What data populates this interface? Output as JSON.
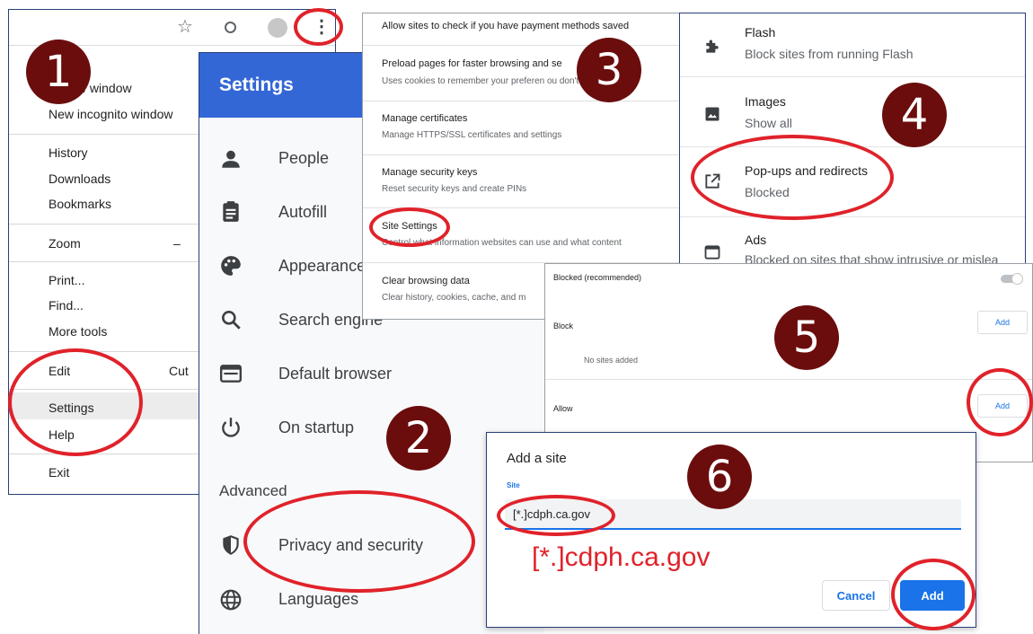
{
  "menu": {
    "item_1": "New window",
    "item_2": "New incognito window",
    "history": "History",
    "downloads": "Downloads",
    "bookmarks": "Bookmarks",
    "zoom": "Zoom",
    "zoom_minus": "–",
    "print": "Print...",
    "find": "Find...",
    "more_tools": "More tools",
    "edit": "Edit",
    "cut": "Cut",
    "settings": "Settings",
    "help": "Help",
    "exit": "Exit",
    "toolbar_star": "☆",
    "toolbar_kebab": "⋮"
  },
  "settings": {
    "title": "Settings",
    "items": [
      {
        "label": "People",
        "icon": "person-icon"
      },
      {
        "label": "Autofill",
        "icon": "clipboard-icon"
      },
      {
        "label": "Appearance",
        "icon": "palette-icon"
      },
      {
        "label": "Search engine",
        "icon": "search-icon"
      },
      {
        "label": "Default browser",
        "icon": "browser-icon"
      },
      {
        "label": "On startup",
        "icon": "power-icon"
      }
    ],
    "advanced": "Advanced",
    "advanced_items": [
      {
        "label": "Privacy and security",
        "icon": "shield-icon"
      },
      {
        "label": "Languages",
        "icon": "globe-icon"
      }
    ]
  },
  "privacy": {
    "rows": [
      {
        "title": "Allow sites to check if you have payment methods saved",
        "sub": ""
      },
      {
        "title": "Preload pages for faster browsing and se",
        "sub": "Uses cookies to remember your preferen                     ou don't"
      },
      {
        "title": "Manage certificates",
        "sub": "Manage HTTPS/SSL certificates and settings"
      },
      {
        "title": "Manage security keys",
        "sub": "Reset security keys and create PINs"
      },
      {
        "title": "Site Settings",
        "sub": "Control what information websites can use and what content"
      },
      {
        "title": "Clear browsing data",
        "sub": "Clear history, cookies, cache, and m"
      }
    ]
  },
  "site_settings": {
    "rows": [
      {
        "title": "Flash",
        "sub": "Block sites from running Flash",
        "icon": "puzzle-icon"
      },
      {
        "title": "Images",
        "sub": "Show all",
        "icon": "image-icon"
      },
      {
        "title": "Pop-ups and redirects",
        "sub": "Blocked",
        "icon": "popup-icon"
      },
      {
        "title": "Ads",
        "sub": "Blocked on sites that show intrusive or mislea",
        "icon": "ads-icon"
      }
    ]
  },
  "popups": {
    "blocked_label": "Blocked (recommended)",
    "block": "Block",
    "add": "Add",
    "no_sites": "No sites added",
    "allow": "Allow"
  },
  "dialog": {
    "title": "Add a site",
    "site_label": "Site",
    "site_value": "[*.]cdph.ca.gov",
    "callout": "[*.]cdph.ca.gov",
    "cancel": "Cancel",
    "add": "Add"
  },
  "steps": [
    "1",
    "2",
    "3",
    "4",
    "5",
    "6"
  ],
  "colors": {
    "accent": "#3367d6",
    "annotation": "#e0222a",
    "badge": "#6b0d0d",
    "primary_button": "#1a73e8"
  }
}
